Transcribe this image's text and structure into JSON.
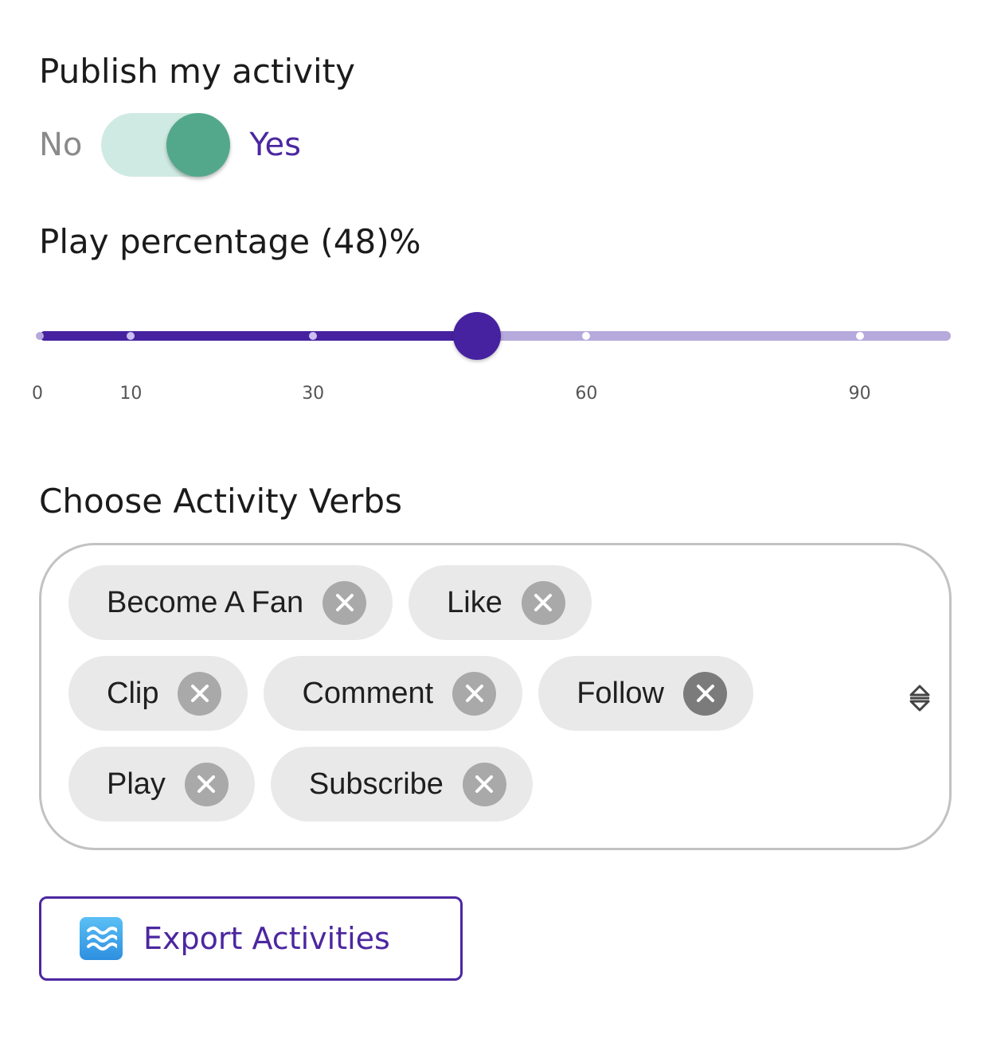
{
  "publish": {
    "title": "Publish my activity",
    "off_label": "No",
    "on_label": "Yes",
    "state": "on"
  },
  "play_percentage": {
    "title": "Play percentage (48)%",
    "value": 48,
    "min": 0,
    "max": 100,
    "marks": [
      {
        "value": 0,
        "label": "0"
      },
      {
        "value": 10,
        "label": "10"
      },
      {
        "value": 30,
        "label": "30"
      },
      {
        "value": 60,
        "label": "60"
      },
      {
        "value": 90,
        "label": "90"
      }
    ]
  },
  "verbs": {
    "title": "Choose Activity Verbs",
    "chips": [
      "Become A Fan",
      "Like",
      "Clip",
      "Comment",
      "Follow",
      "Play",
      "Subscribe"
    ]
  },
  "export": {
    "label": "Export Activities",
    "icon": "water-wave-icon"
  },
  "colors": {
    "accent": "#4622a0",
    "accent_light": "#b6a9db",
    "toggle_on": "#53a88b",
    "toggle_track": "#cfeae2",
    "chip_bg": "#e9e9e9"
  }
}
